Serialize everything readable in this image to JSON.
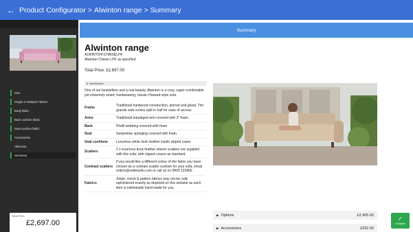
{
  "appbar": {
    "back_icon": "arrow-left-icon",
    "breadcrumbs": [
      "Product Configurator",
      "Alwinton range",
      "Summary"
    ],
    "separator": ">"
  },
  "sidebar": {
    "steps": [
      {
        "label": "Size",
        "state": "done"
      },
      {
        "label": "Single or Multiple Fabrics",
        "state": "done"
      },
      {
        "label": "Body fabric",
        "state": "done"
      },
      {
        "label": "Back cushion fabric",
        "state": "done"
      },
      {
        "label": "Seat cushion fabric",
        "state": "done"
      },
      {
        "label": "Accessories",
        "state": "done"
      },
      {
        "label": "Aftercare",
        "state": "plain"
      },
      {
        "label": "Summary",
        "state": "active"
      }
    ],
    "total_label": "Total Price",
    "total_value": "£2,697.00"
  },
  "main": {
    "section_title": "Summary",
    "product_title": "Alwinton range",
    "product_code": "ALWINTON-CHAISELHF",
    "product_desc": "Alwinton Chaise LHF as specified",
    "total_price": "Total Price: £2,697.00",
    "spec_header": "Specification",
    "spec_intro": "One of our bestsellers and a real beauty, Alwinton is a cosy, super-comfortable yet extremely smart, hardwearing, classic Howard-style sofa.",
    "spec_rows": [
      {
        "key": "Frame",
        "value": "Traditional hardwood construction, pinned and glued. The grande sofa comes split in half for ease of access."
      },
      {
        "key": "Arms",
        "value": "Traditional bandaged arm covered with 2\" foam."
      },
      {
        "key": "Back",
        "value": "Pirelli webbing covered with foam"
      },
      {
        "key": "Seat",
        "value": "Serpentine springing covered with foam."
      },
      {
        "key": "Seat cushions",
        "value": "Luxurious white duck feather inside zipped cases"
      },
      {
        "key": "Scatters",
        "value": "2 x luxurious duck feather interior scatters are supplied with this sofa, with zipped covers as standard."
      },
      {
        "key": "Contrast scatters",
        "value": "If you would like a different colour of the fabric you have chosen as a contrast scatter cushion for your sofa, email orders@settees4u.com or call us on 0800 123456"
      },
      {
        "key": "Fabrics",
        "value": "Stripe, check & pattern fabrics may not be cut& upholstered exactly as depicted on this website as each item is individually hand made for you."
      }
    ],
    "accordions": [
      {
        "label": "Options",
        "amount": "£2,405.00"
      },
      {
        "label": "Accessories",
        "amount": "£292.00"
      }
    ]
  },
  "complete_button": {
    "label": "Complete",
    "icon": "check-icon"
  },
  "colors": {
    "appbar": "#3b6fd6",
    "section_header": "#4a90e2",
    "sidebar": "#2b2b2b",
    "accent_green": "#2ea84f"
  }
}
